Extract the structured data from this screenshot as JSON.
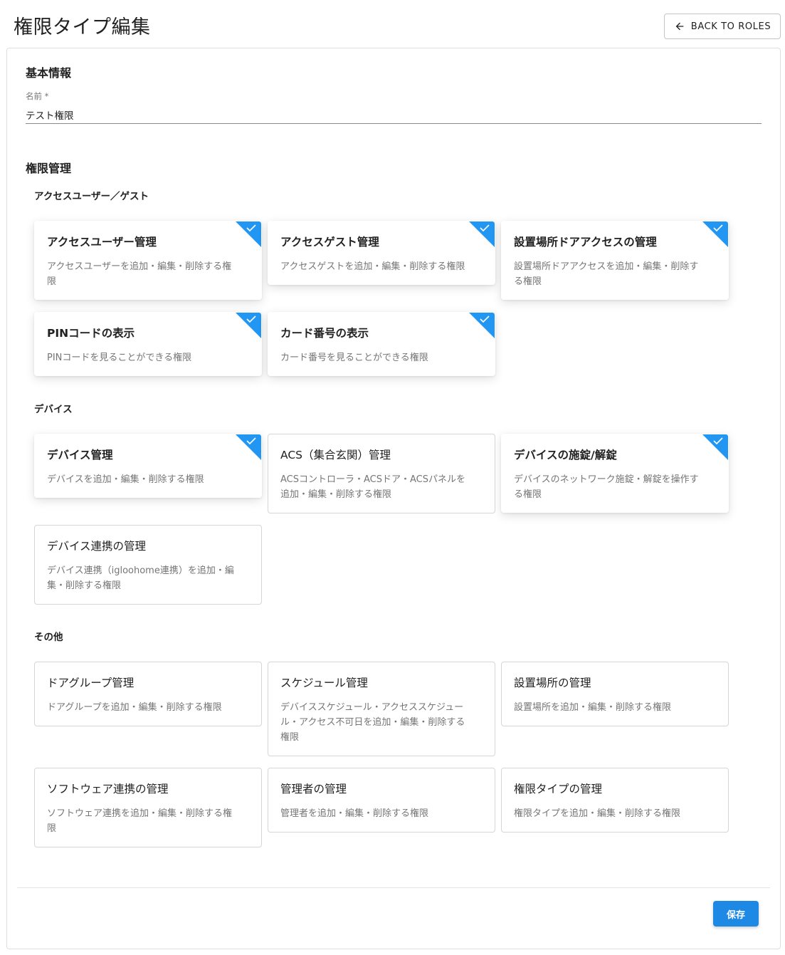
{
  "page": {
    "title": "権限タイプ編集",
    "back_label": "BACK TO ROLES"
  },
  "basic": {
    "section_title": "基本情報",
    "name_label": "名前 *",
    "name_value": "テスト権限"
  },
  "permissions": {
    "section_title": "権限管理",
    "groups": [
      {
        "title": "アクセスユーザー／ゲスト",
        "cards": [
          {
            "title": "アクセスユーザー管理",
            "desc_line1": "アクセスユーザーを追加・編集・削除する権",
            "desc_line2": "限",
            "checked": true
          },
          {
            "title": "アクセスゲスト管理",
            "desc_line1": "アクセスゲストを追加・編集・削除する権限",
            "desc_line2": "",
            "checked": true
          },
          {
            "title": "設置場所ドアアクセスの管理",
            "desc_line1": "設置場所ドアアクセスを追加・編集・削除す",
            "desc_line2": "る権限",
            "checked": true
          },
          {
            "title": "PINコードの表示",
            "desc_line1": "PINコードを見ることができる権限",
            "desc_line2": "",
            "checked": true
          },
          {
            "title": "カード番号の表示",
            "desc_line1": "カード番号を見ることができる権限",
            "desc_line2": "",
            "checked": true
          }
        ]
      },
      {
        "title": "デバイス",
        "cards": [
          {
            "title": "デバイス管理",
            "desc_line1": "デバイスを追加・編集・削除する権限",
            "desc_line2": "",
            "checked": true
          },
          {
            "title": "ACS（集合玄関）管理",
            "desc_line1": "ACSコントローラ・ACSドア・ACSパネルを",
            "desc_line2": "追加・編集・削除する権限",
            "checked": false
          },
          {
            "title": "デバイスの施錠/解錠",
            "desc_line1": "デバイスのネットワーク施錠・解錠を操作す",
            "desc_line2": "る権限",
            "checked": true
          },
          {
            "title": "デバイス連携の管理",
            "desc_line1": "デバイス連携（igloohome連携）を追加・編",
            "desc_line2": "集・削除する権限",
            "checked": false
          }
        ]
      },
      {
        "title": "その他",
        "cards": [
          {
            "title": "ドアグループ管理",
            "desc_line1": "ドアグループを追加・編集・削除する権限",
            "desc_line2": "",
            "desc_line3": "",
            "checked": false
          },
          {
            "title": "スケジュール管理",
            "desc_line1": "デバイススケジュール・アクセススケジュー",
            "desc_line2": "ル・アクセス不可日を追加・編集・削除する",
            "desc_line3": "権限",
            "checked": false
          },
          {
            "title": "設置場所の管理",
            "desc_line1": "設置場所を追加・編集・削除する権限",
            "desc_line2": "",
            "desc_line3": "",
            "checked": false
          },
          {
            "title": "ソフトウェア連携の管理",
            "desc_line1": "ソフトウェア連携を追加・編集・削除する権",
            "desc_line2": "限",
            "desc_line3": "",
            "checked": false
          },
          {
            "title": "管理者の管理",
            "desc_line1": "管理者を追加・編集・削除する権限",
            "desc_line2": "",
            "desc_line3": "",
            "checked": false
          },
          {
            "title": "権限タイプの管理",
            "desc_line1": "権限タイプを追加・編集・削除する権限",
            "desc_line2": "",
            "desc_line3": "",
            "checked": false
          }
        ]
      }
    ]
  },
  "footer": {
    "save_label": "保存"
  },
  "colors": {
    "accent": "#2196f3",
    "save_button": "#1e88e5"
  }
}
